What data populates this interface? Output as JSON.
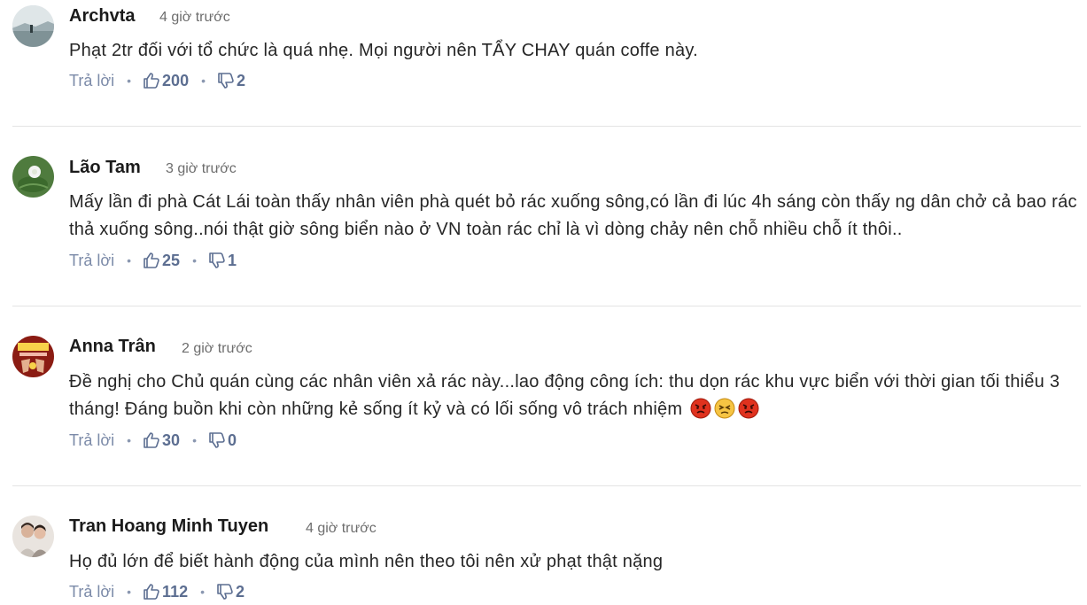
{
  "comments": [
    {
      "name": "Archvta",
      "time": "4 giờ trước",
      "text": "Phạt 2tr đối với tổ chức là quá nhẹ. Mọi người nên TẨY CHAY quán coffe này.",
      "reply": "Trả lời",
      "likes": "200",
      "dislikes": "2",
      "avatar": "landscape-avatar"
    },
    {
      "name": "Lão Tam",
      "time": "3 giờ trước",
      "text": "Mấy lần đi phà Cát Lái toàn thấy nhân viên phà quét bỏ rác xuống sông,có lần đi lúc 4h sáng còn thấy ng dân chở cả bao rác thả xuống sông..nói thật giờ sông biển nào ở VN toàn rác chỉ là vì dòng chảy nên chỗ nhiều chỗ ít thôi..",
      "reply": "Trả lời",
      "likes": "25",
      "dislikes": "1",
      "avatar": "lotus-avatar"
    },
    {
      "name": "Anna Trân",
      "time": "2 giờ trước",
      "text": "Đề nghị cho Chủ quán cùng các nhân viên xả rác này...lao động công ích: thu dọn rác khu vực biển với thời gian tối thiểu 3 tháng! Đáng buồn khi còn những kẻ sống ít kỷ và có lối sống vô trách nhiệm",
      "reply": "Trả lời",
      "likes": "30",
      "dislikes": "0",
      "avatar": "vietnam-avatar",
      "emojis": [
        "angry-face-emoji",
        "persevering-face-emoji",
        "angry-face-emoji"
      ]
    },
    {
      "name": "Tran Hoang Minh Tuyen",
      "time": "4 giờ trước",
      "text": "Họ đủ lớn để biết hành động của mình nên theo tôi nên xử phạt thật nặng",
      "reply": "Trả lời",
      "likes": "112",
      "dislikes": "2",
      "avatar": "photo-avatar"
    }
  ],
  "colors": {
    "action": "#7b8aa8",
    "vote": "#5c6e91",
    "divider": "#e4e4e4"
  }
}
